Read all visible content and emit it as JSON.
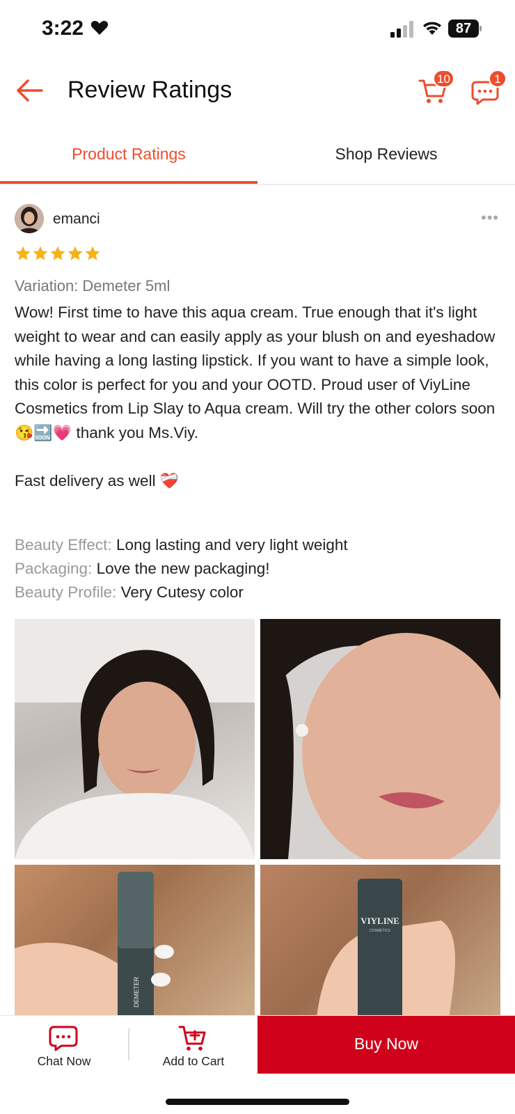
{
  "status_bar": {
    "time": "3:22",
    "battery": "87",
    "icons": [
      "heart-icon",
      "signal-icon",
      "wifi-icon",
      "battery-icon"
    ]
  },
  "header": {
    "title": "Review Ratings",
    "cart_badge": "10",
    "chat_badge": "1",
    "icons": [
      "back-arrow-icon",
      "cart-icon",
      "chat-icon"
    ]
  },
  "tabs": [
    {
      "label": "Product Ratings",
      "active": true
    },
    {
      "label": "Shop Reviews",
      "active": false
    }
  ],
  "review": {
    "username": "emanci",
    "rating": 5,
    "rating_max": 5,
    "variation": "Variation: Demeter 5ml",
    "text_part1": "Wow! First time to have this aqua cream. True enough that it's light weight to wear and can easily apply as your blush on and eyeshadow while having a long lasting lipstick. If you want to have a simple look, this color is perfect for you and your OOTD. Proud user of ViyLine Cosmetics from Lip Slay to Aqua cream. Will try the other colors soon",
    "emojis": "😘🔜💗",
    "text_part2": "thank you Ms.Viy.",
    "text_part3": "Fast delivery as well",
    "text_part3_emoji": "❤️‍🩹",
    "attributes": [
      {
        "label": "Beauty Effect:",
        "value": "Long lasting and very light weight"
      },
      {
        "label": "Packaging:",
        "value": "Love the new packaging!"
      },
      {
        "label": "Beauty Profile:",
        "value": "Very Cutesy color"
      }
    ],
    "photos": [
      "selfie-photo-1",
      "selfie-photo-2",
      "lipstick-photo-1",
      "lipstick-photo-2"
    ],
    "lipstick_text_1": "DEMETER",
    "lipstick_text_2": "VIYLINE",
    "lipstick_text_2_sub": "COSMETICS"
  },
  "bottom_bar": {
    "chat_now": "Chat Now",
    "add_to_cart": "Add to Cart",
    "buy_now": "Buy Now"
  },
  "colors": {
    "accent": "#ee4d2d",
    "buy_now_bg": "#d0011b",
    "star": "#f6b316"
  }
}
